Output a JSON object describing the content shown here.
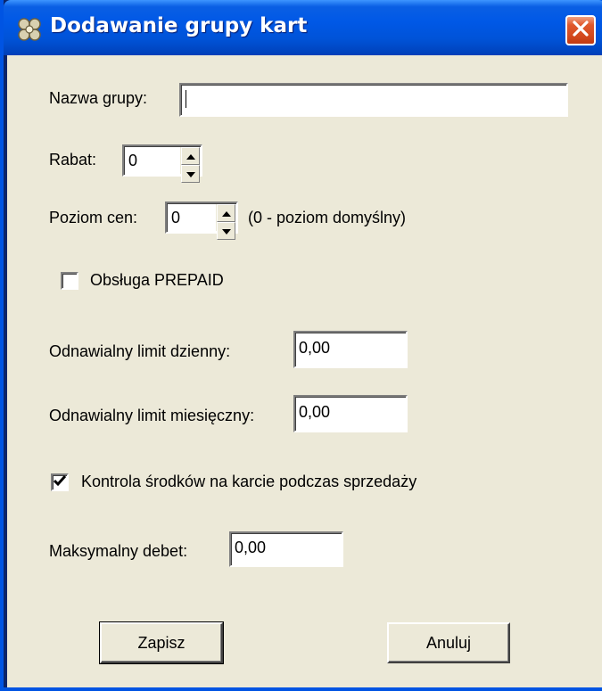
{
  "window": {
    "title": "Dodawanie grupy kart",
    "icon": "app-gears-icon",
    "close_icon": "close-icon"
  },
  "form": {
    "group_name": {
      "label": "Nazwa grupy:",
      "value": ""
    },
    "discount": {
      "label": "Rabat:",
      "value": "0"
    },
    "price_level": {
      "label": "Poziom cen:",
      "value": "0",
      "hint": "(0 - poziom domyślny)"
    },
    "prepaid": {
      "label": "Obsługa PREPAID",
      "checked": false
    },
    "daily_limit": {
      "label": "Odnawialny limit dzienny:",
      "value": "0,00"
    },
    "monthly_limit": {
      "label": "Odnawialny limit miesięczny:",
      "value": "0,00"
    },
    "balance_control": {
      "label": "Kontrola środków na karcie podczas sprzedaży",
      "checked": true
    },
    "max_debit": {
      "label": "Maksymalny debet:",
      "value": "0,00"
    }
  },
  "buttons": {
    "save_label": "Zapisz",
    "cancel_label": "Anuluj"
  },
  "colors": {
    "titlebar": "#0054E3",
    "dialog_bg": "#ECE9D8",
    "close_button": "#D44A1E"
  }
}
